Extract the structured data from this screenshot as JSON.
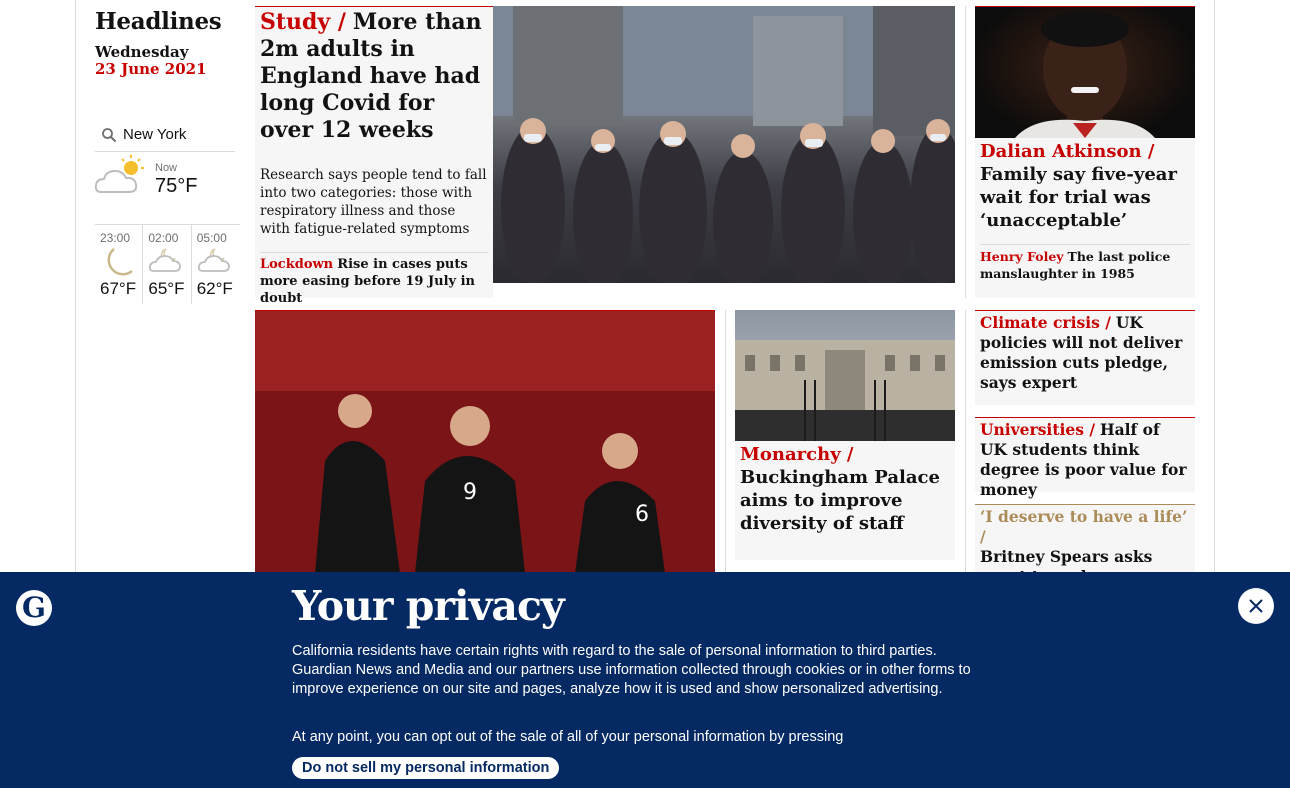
{
  "section": {
    "title": "Headlines",
    "day": "Wednesday",
    "date": "23 June 2021"
  },
  "weather": {
    "location": "New York",
    "now_label": "Now",
    "now_temp": "75°F",
    "forecast": [
      {
        "time": "23:00",
        "temp": "67°F",
        "icon": "moon-icon"
      },
      {
        "time": "02:00",
        "temp": "65°F",
        "icon": "cloud-moon-icon"
      },
      {
        "time": "05:00",
        "temp": "62°F",
        "icon": "cloud-moon-icon"
      }
    ]
  },
  "main_story": {
    "kicker": "Study /",
    "headline": "More than 2m adults in England have had long Covid for over 12 weeks",
    "standfirst": "Research says people tend to fall into two categories: those with respiratory illness and those with fatigue-related symptoms",
    "sublink_kicker": "Lockdown",
    "sublink_text": "Rise in cases puts more easing before 19 July in doubt"
  },
  "dalian": {
    "kicker": "Dalian Atkinson /",
    "headline": "Family say five-year wait for trial was ‘unacceptable’",
    "sublink_kicker": "Henry Foley",
    "sublink_text": "The last police manslaughter in 1985"
  },
  "monarchy": {
    "kicker": "Monarchy /",
    "headline": "Buckingham Palace aims to improve diversity of staff"
  },
  "small_stories": [
    {
      "kicker": "Climate crisis /",
      "headline": "UK policies will not deliver emission cuts pledge, says expert"
    },
    {
      "kicker": "Universities /",
      "headline": "Half of UK students think degree is poor value for money"
    },
    {
      "kicker": "‘I deserve to have a life’ /",
      "headline": "Britney Spears asks court to end conservatorship"
    }
  ],
  "privacy": {
    "title": "Your privacy",
    "body": "California residents have certain rights with regard to the sale of personal information to third parties. Guardian News and Media and our partners use information collected through cookies or in other forms to improve experience on our site and pages, analyze how it is used and show personalized advertising.",
    "body2": "At any point, you can opt out of the sale of all of your personal information by pressing",
    "button": "Do not sell my personal information",
    "logo_letter": "G"
  },
  "colors": {
    "news_red": "#c70000",
    "banner_blue": "#052962",
    "lifestyle_gold": "#ab8b58"
  }
}
